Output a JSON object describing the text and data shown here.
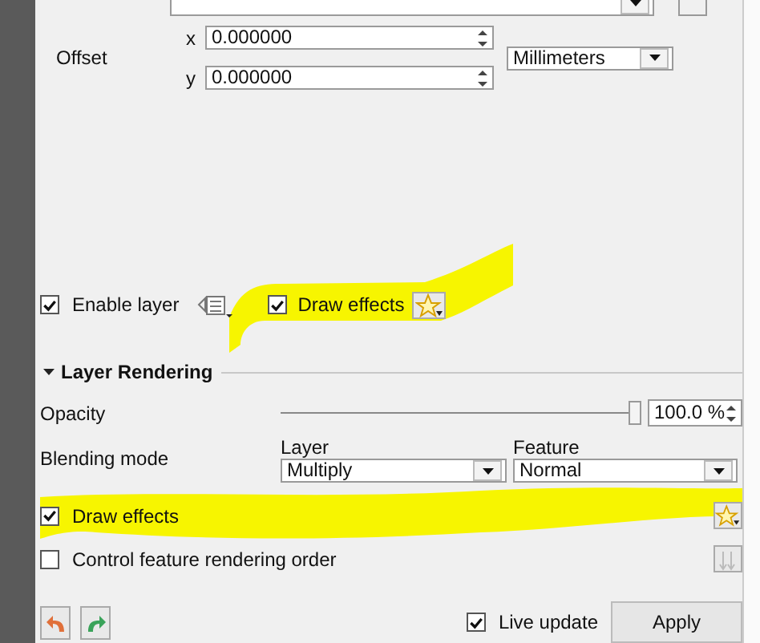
{
  "offset": {
    "label": "Offset",
    "x": {
      "label": "x",
      "value": "0.000000"
    },
    "y": {
      "label": "y",
      "value": "0.000000"
    },
    "unit": "Millimeters"
  },
  "enable_layer": {
    "label": "Enable layer",
    "checked": true
  },
  "draw_effects_top": {
    "label": "Draw effects",
    "checked": true
  },
  "layer_rendering": {
    "title": "Layer Rendering",
    "expanded": true
  },
  "opacity": {
    "label": "Opacity",
    "level": 1.0,
    "value": "100.0 %"
  },
  "blending": {
    "label": "Blending mode",
    "layer": {
      "label": "Layer",
      "value": "Multiply"
    },
    "feature": {
      "label": "Feature",
      "value": "Normal"
    }
  },
  "draw_effects": {
    "label": "Draw effects",
    "checked": true
  },
  "control_order": {
    "label": "Control feature rendering order",
    "checked": false
  },
  "live_update": {
    "label": "Live update",
    "checked": true
  },
  "apply_button": "Apply",
  "annotations": [
    {
      "kind": "highlight"
    },
    {
      "kind": "highlight"
    }
  ]
}
